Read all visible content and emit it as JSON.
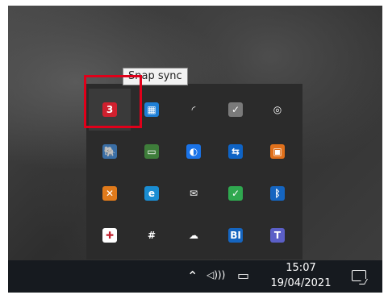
{
  "tooltip": {
    "text": "Snap sync"
  },
  "tray_icons": [
    {
      "name": "snap-sync-icon",
      "glyph": "3",
      "bg": "#d0202e"
    },
    {
      "name": "network-adapter-icon",
      "glyph": "▦",
      "bg": "#1e7fd6"
    },
    {
      "name": "wifi-icon",
      "glyph": "◜",
      "bg": "transparent"
    },
    {
      "name": "printer-ok-icon",
      "glyph": "✓",
      "bg": "#7a7a7a"
    },
    {
      "name": "fingerprint-icon",
      "glyph": "◎",
      "bg": "transparent"
    },
    {
      "name": "postgres-elephant-icon",
      "glyph": "🐘",
      "bg": "#3a6ea5"
    },
    {
      "name": "display-settings-icon",
      "glyph": "▭",
      "bg": "#3e7d3a"
    },
    {
      "name": "sync-blue-icon",
      "glyph": "◐",
      "bg": "#1a73e8"
    },
    {
      "name": "teamviewer-icon",
      "glyph": "⇆",
      "bg": "#0e63c5"
    },
    {
      "name": "contacts-card-icon",
      "glyph": "▣",
      "bg": "#e0701b"
    },
    {
      "name": "java-x-icon",
      "glyph": "✕",
      "bg": "#e07a1b"
    },
    {
      "name": "edge-icon",
      "glyph": "e",
      "bg": "#1a8dd2"
    },
    {
      "name": "mail-icon",
      "glyph": "✉",
      "bg": "transparent"
    },
    {
      "name": "green-check-icon",
      "glyph": "✓",
      "bg": "#2fa84f"
    },
    {
      "name": "bluetooth-icon",
      "glyph": "ᛒ",
      "bg": "#1565c0"
    },
    {
      "name": "security-shield-icon",
      "glyph": "✚",
      "bg": "#ffffff"
    },
    {
      "name": "slack-icon",
      "glyph": "#",
      "bg": "transparent"
    },
    {
      "name": "cloud-offline-icon",
      "glyph": "☁",
      "bg": "transparent"
    },
    {
      "name": "bi-icon",
      "glyph": "BI",
      "bg": "#1565c0"
    },
    {
      "name": "teams-icon",
      "glyph": "T",
      "bg": "#5b5fc7"
    }
  ],
  "taskbar": {
    "chevron_glyph": "⌃",
    "volume_glyph": "◁)))",
    "battery_glyph": "▭",
    "time": "15:07",
    "date": "19/04/2021"
  }
}
